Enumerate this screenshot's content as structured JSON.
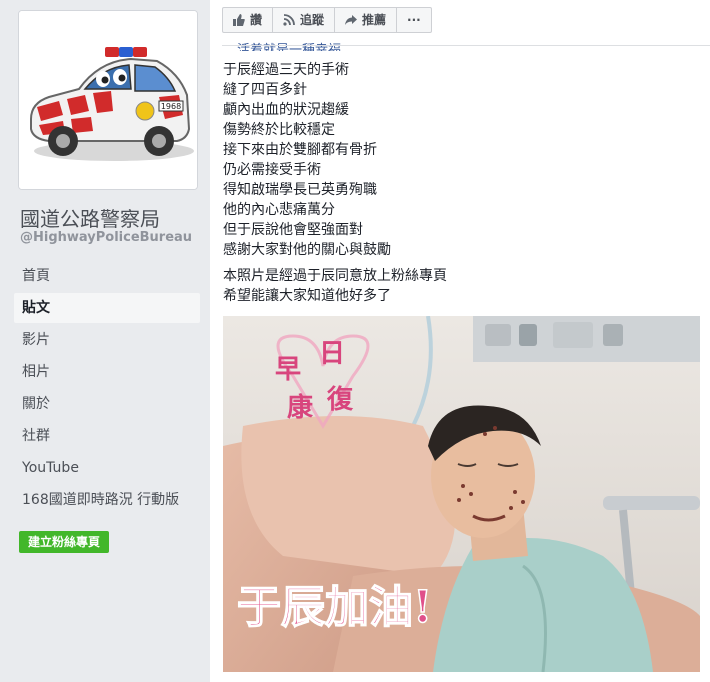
{
  "sidebar": {
    "page_name": "國道公路警察局",
    "page_handle": "@HighwayPoliceBureau",
    "nav": [
      {
        "label": "首頁",
        "active": false
      },
      {
        "label": "貼文",
        "active": true
      },
      {
        "label": "影片",
        "active": false
      },
      {
        "label": "相片",
        "active": false
      },
      {
        "label": "關於",
        "active": false
      },
      {
        "label": "社群",
        "active": false
      },
      {
        "label": "YouTube",
        "active": false
      },
      {
        "label": "168國道即時路況 行動版",
        "active": false
      }
    ],
    "create_page_label": "建立粉絲專頁",
    "profile_car_plate": "1968"
  },
  "actions": {
    "like_label": "讚",
    "follow_label": "追蹤",
    "share_label": "推薦",
    "more_label": "···"
  },
  "post": {
    "cut_line": "…活着就是一種幸福",
    "lines": [
      "于辰經過三天的手術",
      "縫了四百多針",
      "顱內出血的狀況趨緩",
      "傷勢終於比較穩定",
      "接下來由於雙腳都有骨折",
      "仍必需接受手術",
      "得知啟瑞學長已英勇殉職",
      "他的內心悲痛萬分",
      "但于辰說他會堅強面對",
      "感謝大家對他的關心與鼓勵"
    ],
    "lines2": [
      "本照片是經過于辰同意放上粉絲專頁",
      "希望能讓大家知道他好多了"
    ],
    "photo": {
      "overlay_top": [
        "早",
        "日",
        "康",
        "復"
      ],
      "overlay_bottom": "于辰加油!"
    }
  },
  "colors": {
    "brand_blue": "#365899",
    "create_green": "#42b72a",
    "overlay_pink": "#e0508a"
  }
}
